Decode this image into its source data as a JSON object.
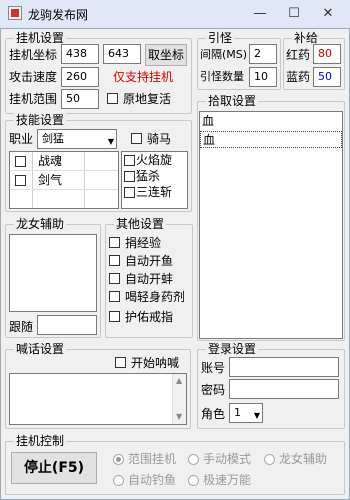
{
  "window": {
    "title": "龙驹发布网",
    "minimize": "—",
    "maximize": "☐",
    "close": "✕"
  },
  "hang": {
    "legend": "挂机设置",
    "coord_label": "挂机坐标",
    "coord_x": "438",
    "coord_y": "643",
    "get_coord_button": "取坐标",
    "speed_label": "攻击速度",
    "speed": "260",
    "only_support": "仅支持挂机",
    "range_label": "挂机范围",
    "range": "50",
    "revive_label": "原地复活"
  },
  "monster": {
    "legend": "引怪",
    "interval_label": "间隔(MS)",
    "interval": "2",
    "count_label": "引怪数量",
    "count": "10"
  },
  "supply": {
    "legend": "补给",
    "red_label": "红药",
    "red": "80",
    "blue_label": "蓝药",
    "blue": "50"
  },
  "skill": {
    "legend": "技能设置",
    "job_label": "职业",
    "job": "剑猛",
    "mount_label": "骑马",
    "skills": [
      "战魂",
      "剑气"
    ],
    "skills_right": [
      "火焰旋",
      "猛杀",
      "三连斩"
    ]
  },
  "pickup": {
    "legend": "拾取设置",
    "items": [
      "血",
      "血"
    ]
  },
  "dragon": {
    "legend": "龙女辅助",
    "follow_label": "跟随"
  },
  "other": {
    "legend": "其他设置",
    "items": [
      "捐经验",
      "自动开鱼",
      "自动开蚌",
      "喝轻身药剂",
      "护佑戒指"
    ]
  },
  "shout": {
    "legend": "喊话设置",
    "start_label": "开始呐喊"
  },
  "login": {
    "legend": "登录设置",
    "account_label": "账号",
    "password_label": "密码",
    "role_label": "角色",
    "role": "1"
  },
  "control": {
    "legend": "挂机控制",
    "stop_button": "停止(F5)",
    "modes": [
      "范围挂机",
      "手动模式",
      "龙女辅助",
      "自动钓鱼",
      "极速万能"
    ]
  }
}
